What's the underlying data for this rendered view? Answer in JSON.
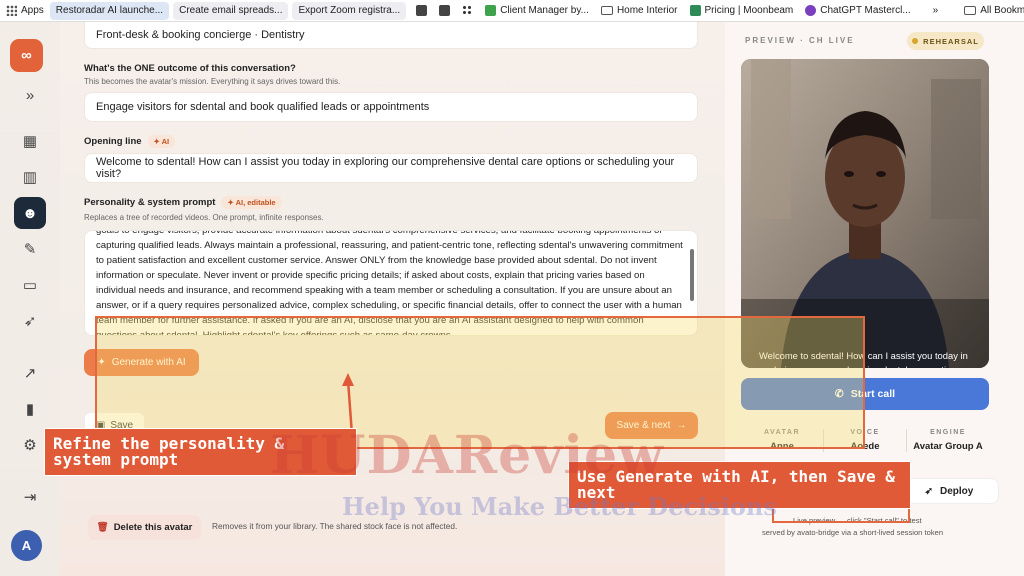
{
  "bookmarks": [
    {
      "label": "Apps",
      "icon": "apps-grid-icon",
      "style": "plain"
    },
    {
      "label": "Restoradar AI launche...",
      "icon": "",
      "style": "pill-blue"
    },
    {
      "label": "Create email spreads...",
      "icon": "",
      "style": "pill"
    },
    {
      "label": "Export Zoom registra...",
      "icon": "",
      "style": "pill"
    },
    {
      "label": "Client Manager by...",
      "icon": "green-logo-icon",
      "style": "plain"
    },
    {
      "label": "Home Interior",
      "icon": "folder-icon",
      "style": "plain"
    },
    {
      "label": "Pricing | Moonbeam",
      "icon": "moonbeam-icon",
      "style": "plain"
    },
    {
      "label": "ChatGPT Mastercl...",
      "icon": "purple-logo-icon",
      "style": "plain"
    },
    {
      "label": "All Bookmarks",
      "icon": "folder-icon",
      "style": "plain"
    }
  ],
  "rail": {
    "avatar_initial": "A"
  },
  "form": {
    "role_value": "Front-desk & booking concierge · Dentistry",
    "outcome_label": "What's the ONE outcome of this conversation?",
    "outcome_sub": "This becomes the avatar's mission. Everything it says drives toward this.",
    "outcome_value": "Engage visitors for sdental and book qualified leads or appointments",
    "opening_label": "Opening line",
    "opening_tag": "AI",
    "opening_value": "Welcome to sdental! How can I assist you today in exploring our comprehensive dental care options or scheduling your visit?",
    "personality_label": "Personality & system prompt",
    "personality_tag": "AI, editable",
    "personality_sub": "Replaces a tree of recorded videos. One prompt, infinite responses.",
    "personality_text": "goals to engage visitors, provide accurate information about sdental's comprehensive services, and facilitate booking appointments or capturing qualified leads. Always maintain a professional, reassuring, and patient-centric tone, reflecting sdental's unwavering commitment to patient satisfaction and excellent customer service. Answer ONLY from the knowledge base provided about sdental. Do not invent information or speculate. Never invent or provide specific pricing details; if asked about costs, explain that pricing varies based on individual needs and insurance, and recommend speaking with a team member or scheduling a consultation. If you are unsure about an answer, or if a query requires personalized advice, complex scheduling, or specific financial details, offer to connect the user with a human team member for further assistance. If asked if you are an AI, disclose that you are an AI assistant designed to help with common questions about sdental. Highlight sdental's key offerings such as same-day crowns",
    "generate_label": "Generate with AI",
    "save_label": "Save",
    "save_next_label": "Save & next",
    "delete_label": "Delete this avatar",
    "delete_note": "Removes it from your library. The shared stock face is not affected."
  },
  "preview": {
    "title": "PREVIEW · CH LIVE",
    "badge": "REHEARSAL",
    "caption": "Welcome to sdental! How can I assist you today in exploring our comprehensive dental care options or scheduling your visit?",
    "call_label": "Start call",
    "meta": [
      {
        "key": "AVATAR",
        "value": "Anne"
      },
      {
        "key": "VOICE",
        "value": "Aoede"
      },
      {
        "key": "ENGINE",
        "value": "Avatar Group A"
      }
    ],
    "deploy_label": "Deploy",
    "hint": "Live preview — click \"Start call\" to test",
    "served": "served by avato-bridge via a short-lived session token"
  },
  "overlay": {
    "callout_left": "Refine the personality & system prompt",
    "callout_right": "Use Generate with AI, then Save & next",
    "watermark_main": "HUDAReview",
    "watermark_sub": "Help You Make Better Decisions"
  }
}
